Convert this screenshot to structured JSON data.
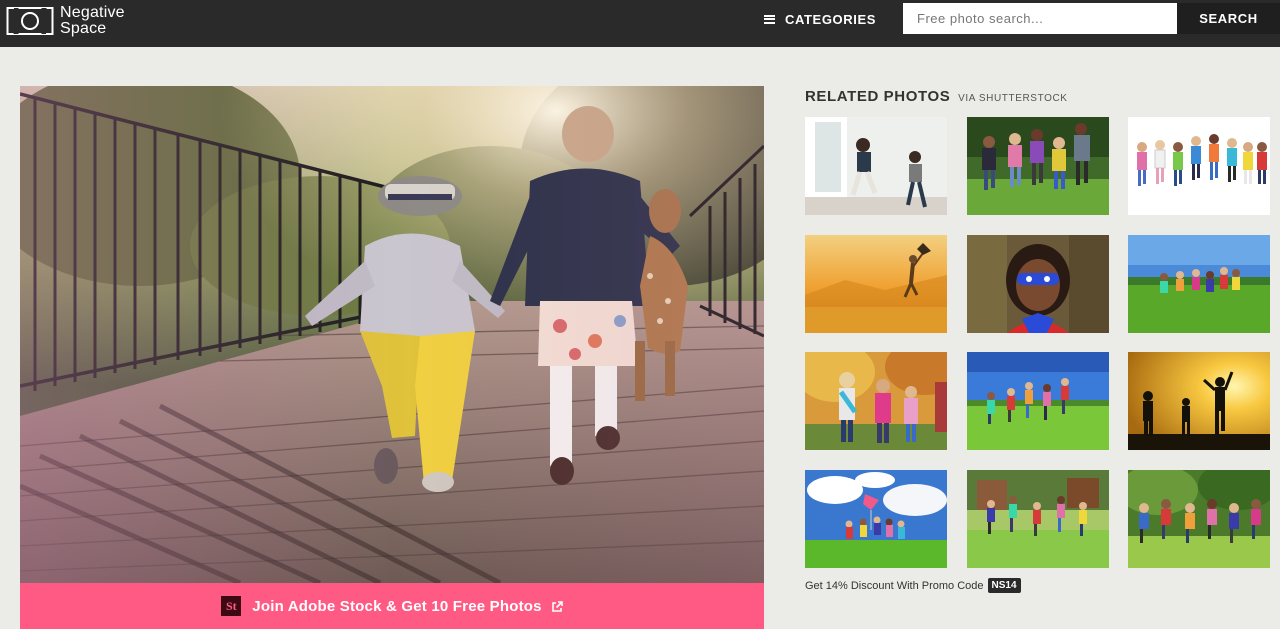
{
  "header": {
    "logo_line1": "Negative",
    "logo_line2": "Space",
    "categories_label": "CATEGORIES",
    "search_placeholder": "Free photo search...",
    "search_button": "SEARCH"
  },
  "main_photo": {
    "subject": "two-children-walking-on-bridge"
  },
  "adobe_bar": {
    "badge": "St",
    "label": "Join Adobe Stock & Get 10 Free Photos",
    "color": "#ff5a83"
  },
  "related": {
    "title": "RELATED PHOTOS",
    "via": "VIA SHUTTERSTOCK",
    "thumbs": [
      {
        "name": "thumb-children-running-indoors"
      },
      {
        "name": "thumb-children-running-park"
      },
      {
        "name": "thumb-children-group-white"
      },
      {
        "name": "thumb-child-kite-sunset"
      },
      {
        "name": "thumb-superhero-kid"
      },
      {
        "name": "thumb-kids-running-field"
      },
      {
        "name": "thumb-girls-autumn"
      },
      {
        "name": "thumb-kids-running-meadow"
      },
      {
        "name": "thumb-silhouette-sunset"
      },
      {
        "name": "thumb-kids-kite-sky"
      },
      {
        "name": "thumb-kids-playground"
      },
      {
        "name": "thumb-kids-running-trees"
      }
    ],
    "promo_text": "Get 14% Discount With Promo Code",
    "promo_code": "NS14"
  }
}
